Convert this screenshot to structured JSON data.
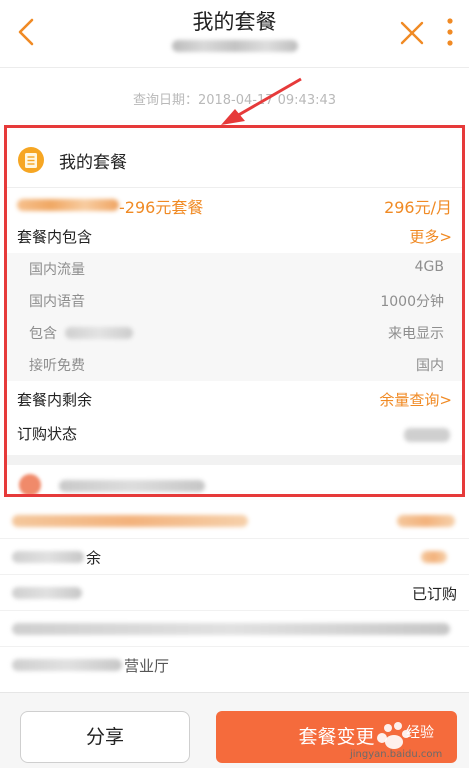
{
  "header": {
    "title": "我的套餐",
    "back_icon": "chevron-left-icon",
    "close_icon": "close-icon",
    "more_icon": "more-vertical-icon"
  },
  "query": {
    "date_text": "查询日期：2018-04-17 09:43:43"
  },
  "card": {
    "title": "我的套餐",
    "plan_name": "-296元套餐",
    "plan_price": "296元/月",
    "includes_label": "套餐内包含",
    "more_link": "更多>",
    "details": [
      {
        "label": "国内流量",
        "value": "4GB"
      },
      {
        "label": "国内语音",
        "value": "1000分钟"
      },
      {
        "label": "包含",
        "value": "来电显示"
      },
      {
        "label": "接听免费",
        "value": "国内"
      }
    ],
    "remain_label": "套餐内剩余",
    "remain_link": "余量查询>",
    "status_label": "订购状态"
  },
  "list": {
    "row2_suffix": "余",
    "subscribed": "已订购",
    "row5_suffix": "营业厅"
  },
  "bottom": {
    "share_label": "分享",
    "change_label": "套餐变更",
    "watermark_text": "经验",
    "watermark_url": "jingyan.baidu.com"
  },
  "colors": {
    "accent": "#f08a24",
    "highlight_border": "#e63a3a",
    "button": "#f56b3c"
  }
}
